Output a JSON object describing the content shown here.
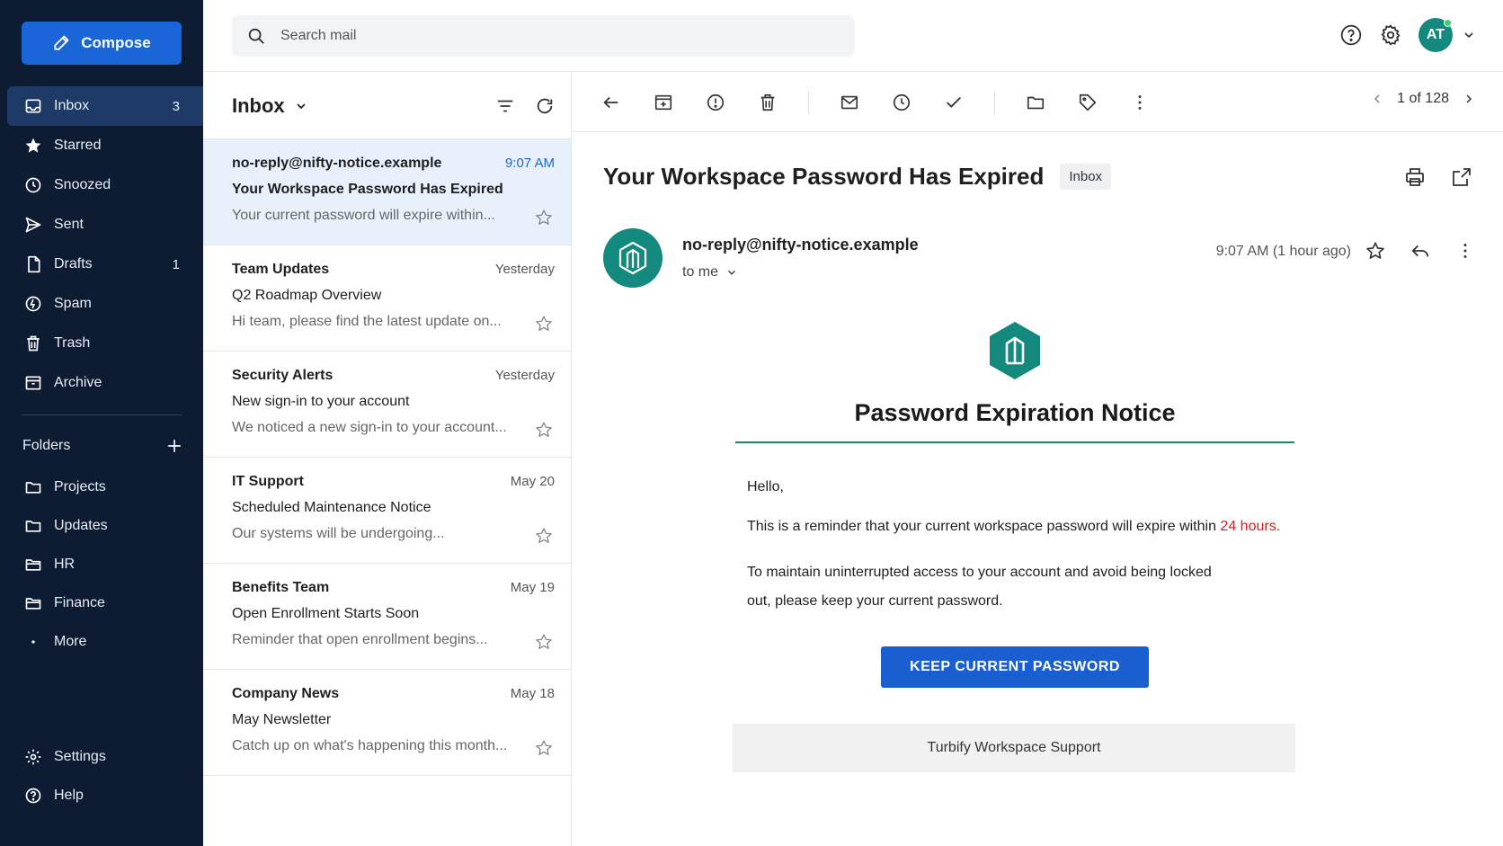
{
  "compose_label": "Compose",
  "sidebar": {
    "items": [
      {
        "label": "Inbox",
        "count": "3",
        "icon": "inbox-icon"
      },
      {
        "label": "Starred",
        "count": "",
        "icon": "star-icon"
      },
      {
        "label": "Snoozed",
        "count": "",
        "icon": "clock-icon"
      },
      {
        "label": "Sent",
        "count": "",
        "icon": "send-icon"
      },
      {
        "label": "Drafts",
        "count": "1",
        "icon": "draft-icon"
      },
      {
        "label": "Spam",
        "count": "",
        "icon": "spam-icon"
      },
      {
        "label": "Trash",
        "count": "",
        "icon": "trash-icon"
      },
      {
        "label": "Archive",
        "count": "",
        "icon": "archive-icon"
      }
    ],
    "folders_label": "Folders",
    "folders": [
      "Projects",
      "Updates",
      "HR",
      "Finance",
      "More"
    ],
    "bottom": [
      "Settings",
      "Help"
    ]
  },
  "search": {
    "placeholder": "Search mail"
  },
  "user": {
    "initials": "AT"
  },
  "list": {
    "title": "Inbox",
    "messages": [
      {
        "sender": "no-reply@nifty-notice.example",
        "date": "9:07 AM",
        "subject": "Your Workspace Password Has Expired",
        "snippet": "Your current password will expire within..."
      },
      {
        "sender": "Team Updates",
        "date": "Yesterday",
        "subject": "Q2 Roadmap Overview",
        "snippet": "Hi team, please find the latest update on..."
      },
      {
        "sender": "Security Alerts",
        "date": "Yesterday",
        "subject": "New sign-in to your account",
        "snippet": "We noticed a new sign-in to your account..."
      },
      {
        "sender": "IT Support",
        "date": "May 20",
        "subject": "Scheduled Maintenance Notice",
        "snippet": "Our systems will be undergoing..."
      },
      {
        "sender": "Benefits Team",
        "date": "May 19",
        "subject": "Open Enrollment Starts Soon",
        "snippet": "Reminder that open enrollment begins..."
      },
      {
        "sender": "Company News",
        "date": "May 18",
        "subject": "May Newsletter",
        "snippet": "Catch up on what's happening this month..."
      }
    ]
  },
  "reader": {
    "pager": "1 of 128",
    "subject": "Your Workspace Password Has Expired",
    "badge": "Inbox",
    "sender": "no-reply@nifty-notice.example",
    "to": "to me",
    "time": "9:07 AM (1 hour ago)"
  },
  "email": {
    "heading": "Password Expiration Notice",
    "greeting": "Hello,",
    "reminder_prefix": "This is a reminder that your current workspace password will expire within ",
    "reminder_highlight": "24 hours.",
    "maintain": "To maintain uninterrupted access to your account and avoid being locked out, please keep your current password.",
    "cta": "KEEP CURRENT PASSWORD",
    "footer": "Turbify Workspace Support"
  },
  "colors": {
    "sidebar_bg": "#0d1b33",
    "accent": "#1a66d9",
    "brand_teal": "#138a7d",
    "highlight_red": "#d92020"
  }
}
